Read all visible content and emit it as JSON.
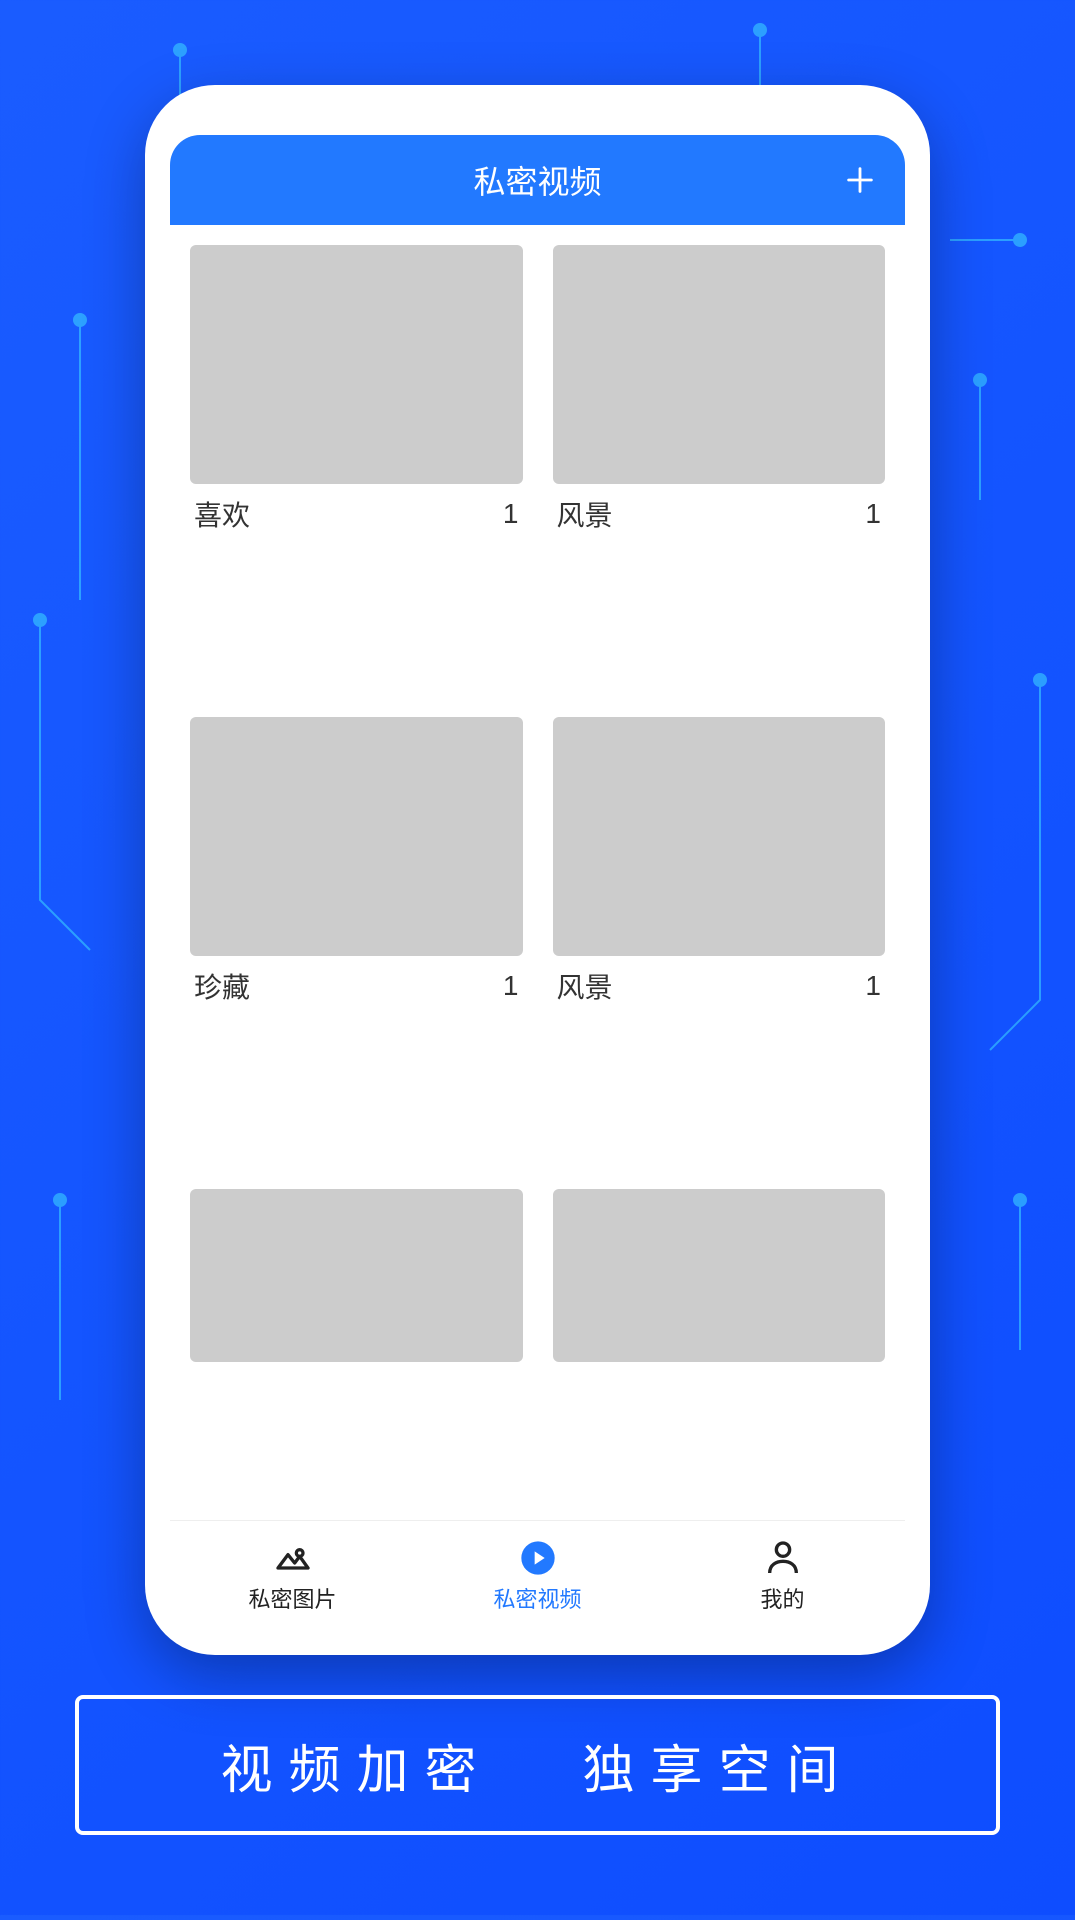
{
  "header": {
    "title": "私密视频"
  },
  "albums": [
    {
      "label": "喜欢",
      "count": "1",
      "thumb_class": "thumb-mountains"
    },
    {
      "label": "风景",
      "count": "1",
      "thumb_class": "thumb-street"
    },
    {
      "label": "珍藏",
      "count": "1",
      "thumb_class": "thumb-city"
    },
    {
      "label": "风景",
      "count": "1",
      "thumb_class": "thumb-flowers"
    },
    {
      "label": "",
      "count": "",
      "thumb_class": "thumb-bokeh",
      "partial": true
    },
    {
      "label": "",
      "count": "",
      "thumb_class": "thumb-concert",
      "partial": true
    }
  ],
  "nav": {
    "tab0": {
      "label": "私密图片"
    },
    "tab1": {
      "label": "私密视频"
    },
    "tab2": {
      "label": "我的"
    }
  },
  "banner": {
    "left": "视频加密",
    "right": "独享空间"
  }
}
